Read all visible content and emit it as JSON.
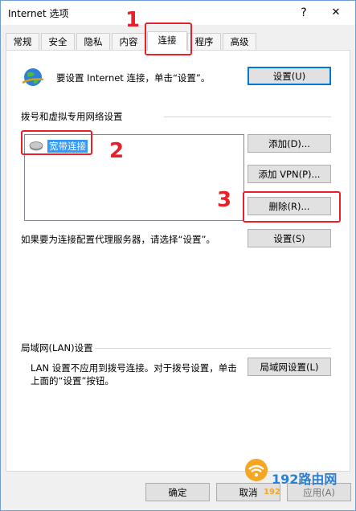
{
  "window": {
    "title": "Internet 选项",
    "help_glyph": "?",
    "close_glyph": "✕"
  },
  "tabs": [
    {
      "label": "常规"
    },
    {
      "label": "安全"
    },
    {
      "label": "隐私"
    },
    {
      "label": "内容"
    },
    {
      "label": "连接"
    },
    {
      "label": "程序"
    },
    {
      "label": "高级"
    }
  ],
  "setup": {
    "text": "要设置 Internet 连接，单击“设置”。",
    "button": "设置(U)"
  },
  "dialup": {
    "heading": "拨号和虚拟专用网络设置",
    "connections": [
      "宽带连接"
    ],
    "add_button": "添加(D)...",
    "add_vpn_button": "添加 VPN(P)...",
    "delete_button": "删除(R)...",
    "proxy_text": "如果要为连接配置代理服务器，请选择“设置”。",
    "settings_button": "设置(S)"
  },
  "lan": {
    "heading": "局域网(LAN)设置",
    "text_line1": "LAN 设置不应用到拨号连接。对于拨号设置，单击",
    "text_line2": "上面的“设置”按钮。",
    "button": "局域网设置(L)"
  },
  "footer": {
    "ok": "确定",
    "cancel": "取消",
    "apply": "应用(A)"
  },
  "annotations": {
    "step1": "1",
    "step2": "2",
    "step3": "3",
    "accent_color": "#e8202a"
  },
  "watermark": {
    "brand": "192路由网",
    "host": "192"
  }
}
